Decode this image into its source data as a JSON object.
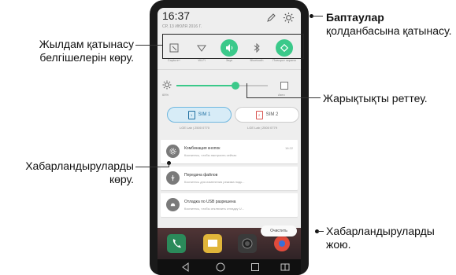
{
  "status": {
    "time": "16:37",
    "date": "СР, 13 ИЮЛЯ 2016 Г."
  },
  "quick_settings": [
    {
      "label": "Capture+",
      "icon": "capture-icon",
      "active": false
    },
    {
      "label": "Wi-Fi",
      "icon": "wifi-icon",
      "active": false
    },
    {
      "label": "Звук",
      "icon": "sound-icon",
      "active": true
    },
    {
      "label": "Bluetooth",
      "icon": "bluetooth-icon",
      "active": false
    },
    {
      "label": "Поворот экрана",
      "icon": "rotate-icon",
      "active": true
    }
  ],
  "brightness": {
    "percent_label": "65%",
    "level": 0.65,
    "auto_label": "Авто"
  },
  "sims": [
    {
      "label": "SIM 1",
      "chip": "1",
      "sub": "LGE Lab | 2500 0770"
    },
    {
      "label": "SIM 2",
      "chip": "2",
      "sub": "LGE Lab | 2500 0779"
    }
  ],
  "notifications": [
    {
      "title": "Комбинация кнопок",
      "text": "Коснитесь, чтобы настроить сейчас",
      "time": "16:22"
    },
    {
      "title": "Передача файлов",
      "text": "Коснитесь для изменения режима подк...",
      "time": ""
    },
    {
      "title": "Отладка по USB разрешена",
      "text": "Коснитесь, чтобы отключить отладку U...",
      "time": ""
    }
  ],
  "clear_label": "Очистить",
  "callouts": {
    "settings_bold": "Баптаулар",
    "settings_rest": "қолданбасына қатынасу.",
    "quick": "Жылдам қатынасу белгішелерін көру.",
    "brightness": "Жарықтықты реттеу.",
    "notifications": "Хабарландыруларды көру.",
    "clear": "Хабарландыруларды жою."
  },
  "colors": {
    "accent": "#3bc98a",
    "sim_active": "#6fb7df"
  }
}
